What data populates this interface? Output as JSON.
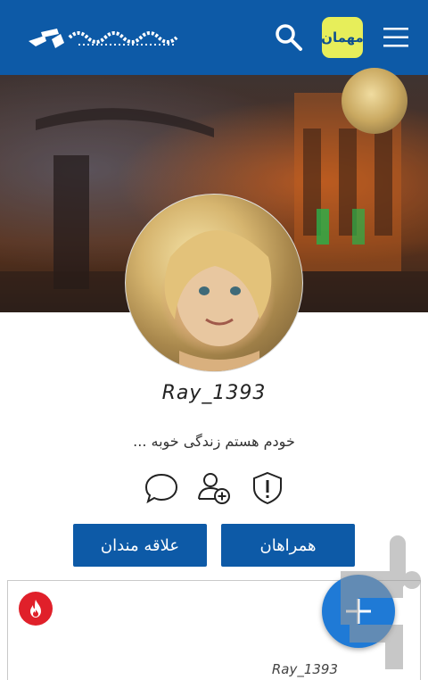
{
  "header": {
    "logo_text": "",
    "guest_label": "مهمان"
  },
  "profile": {
    "username": "Ray_1393",
    "bio": "خودم هستم زندگی خوبه ..."
  },
  "actions": {
    "followers_label": "همراهان",
    "interests_label": "علاقه مندان"
  },
  "post": {
    "author": "Ray_1393"
  },
  "colors": {
    "header": "#0d5aa7",
    "guest_bg": "#e7ee5a",
    "button": "#0d5aa7",
    "fab": "#1f7ad6",
    "hot": "#e0202a"
  }
}
